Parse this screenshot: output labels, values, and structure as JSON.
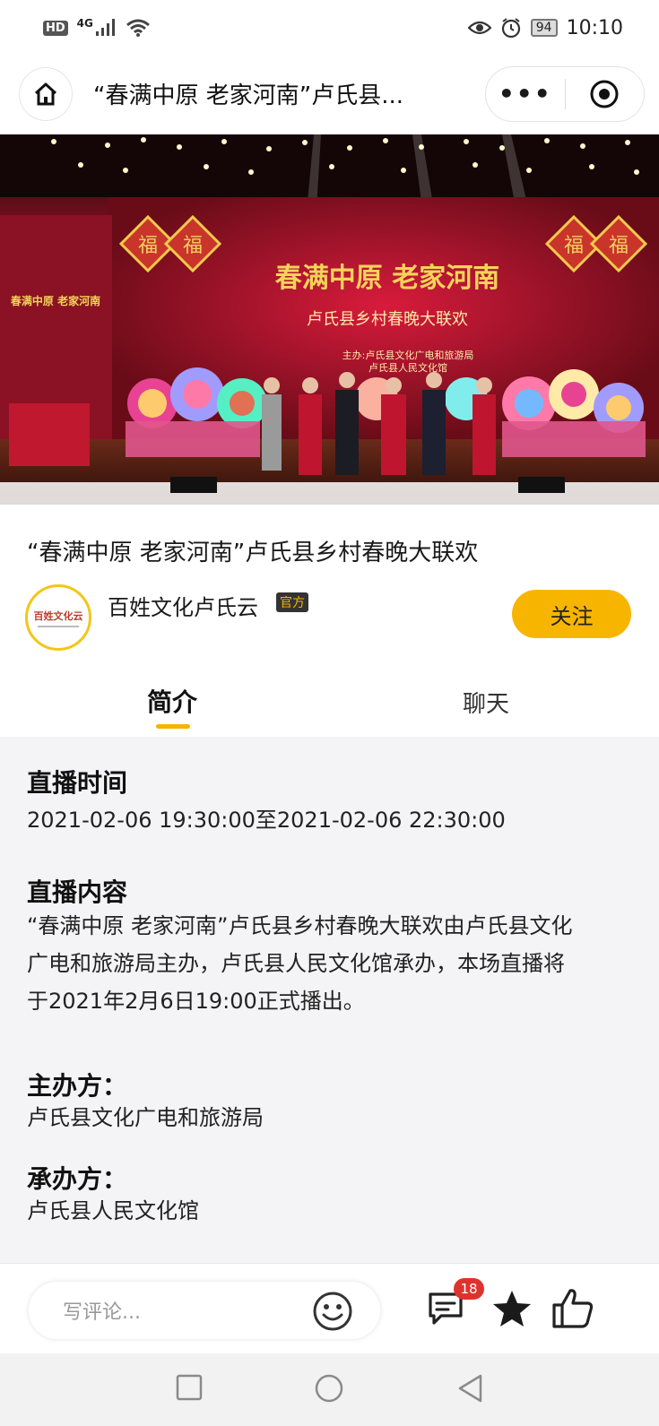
{
  "status_bar": {
    "hd": "HD",
    "network": "4G",
    "battery": "94",
    "time": "10:10"
  },
  "title_bar": {
    "title": "“春满中原  老家河南”卢氏县...",
    "home_icon": "home-icon",
    "more_icon": "more-dots-icon",
    "close_icon": "close-target-icon"
  },
  "video": {
    "banner_main": "春满中原  老家河南",
    "banner_sub": "卢氏县乡村春晚大联欢",
    "banner_host": "主办:卢氏县文化广电和旅游局",
    "banner_organizer": "卢氏县人民文化馆",
    "side_banner": "春满中原  老家河南",
    "fu_left": "福",
    "fu_right": "福"
  },
  "program": {
    "title": "“春满中原 老家河南”卢氏县乡村春晚大联欢"
  },
  "publisher": {
    "logo_text": "百姓文化云",
    "name": "百姓文化卢氏云",
    "badge": "官方",
    "follow_label": "关注"
  },
  "tabs": {
    "intro": "简介",
    "chat": "聊天"
  },
  "info": {
    "time_heading": "直播时间",
    "time_value": "2021-02-06 19:30:00至2021-02-06 22:30:00",
    "content_heading": "直播内容",
    "content_line1": "“春满中原 老家河南”卢氏县乡村春晚大联欢由卢氏县文化",
    "content_line2": "广电和旅游局主办，卢氏县人民文化馆承办，本场直播将",
    "content_line3": "于2021年2月6日19:00正式播出。",
    "host_heading": "主办方：",
    "host_value": "卢氏县文化广电和旅游局",
    "organizer_heading": "承办方：",
    "organizer_value": "卢氏县人民文化馆"
  },
  "bottom_bar": {
    "comment_placeholder": "写评论...",
    "comment_count": "18"
  },
  "colors": {
    "accent": "#f7b500",
    "badge_red": "#e0322d",
    "panel_bg": "#f4f4f6"
  }
}
